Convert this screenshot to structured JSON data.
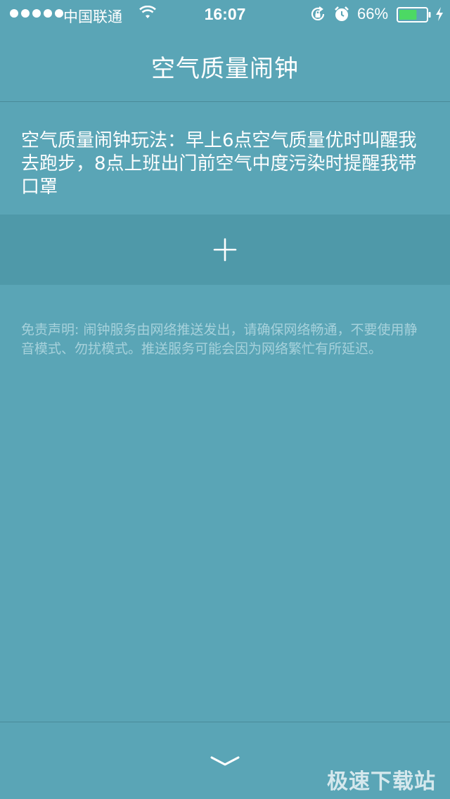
{
  "status_bar": {
    "carrier": "中国联通",
    "time": "16:07",
    "battery_percent": "66%",
    "battery_level": 0.66,
    "icons": [
      "signal-dots",
      "wifi-icon",
      "rotation-lock-icon",
      "alarm-icon",
      "battery-icon",
      "charging-icon"
    ]
  },
  "nav": {
    "title": "空气质量闹钟"
  },
  "intro": {
    "text": "空气质量闹钟玩法：早上6点空气质量优时叫醒我去跑步，8点上班出门前空气中度污染时提醒我带口罩"
  },
  "add_alarm": {
    "icon": "plus-icon"
  },
  "disclaimer": {
    "text": "免责声明: 闹钟服务由网络推送发出，请确保网络畅通，不要使用静音模式、勿扰模式。推送服务可能会因为网络繁忙有所延迟。"
  },
  "footer": {
    "collapse_icon": "chevron-down-icon",
    "watermark": "极速下载站"
  },
  "colors": {
    "background": "#5aa5b6",
    "add_band": "#4f99a9",
    "disclaimer_text": "#a6d1db",
    "battery_fill": "#4cd964"
  }
}
